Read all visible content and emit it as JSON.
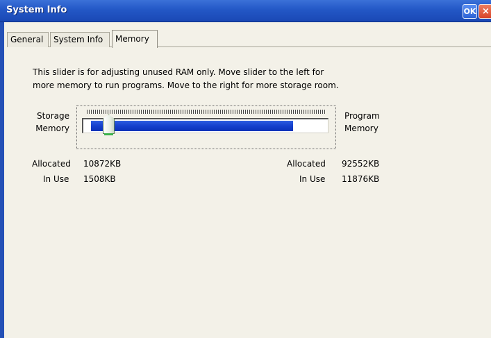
{
  "window": {
    "title": "System Info",
    "ok_label": "OK",
    "close_label": "×"
  },
  "tabs": [
    {
      "label": "General",
      "active": false
    },
    {
      "label": "System Info",
      "active": false
    },
    {
      "label": "Memory",
      "active": true
    }
  ],
  "memory": {
    "description_line1": "This slider is for adjusting unused RAM only.  Move slider to the left for",
    "description_line2": "more memory to run programs. Move to the right for more storage room.",
    "left_label_line1": "Storage",
    "left_label_line2": "Memory",
    "right_label_line1": "Program",
    "right_label_line2": "Memory",
    "slider_position_fraction": 0.105,
    "storage": {
      "allocated_label": "Allocated",
      "allocated_value": "10872KB",
      "inuse_label": "In Use",
      "inuse_value": "1508KB"
    },
    "program": {
      "allocated_label": "Allocated",
      "allocated_value": "92552KB",
      "inuse_label": "In Use",
      "inuse_value": "11876KB"
    }
  },
  "colors": {
    "titlebar": "#2357c6",
    "slider_fill": "#1540cc",
    "background": "#f3f1e8"
  }
}
